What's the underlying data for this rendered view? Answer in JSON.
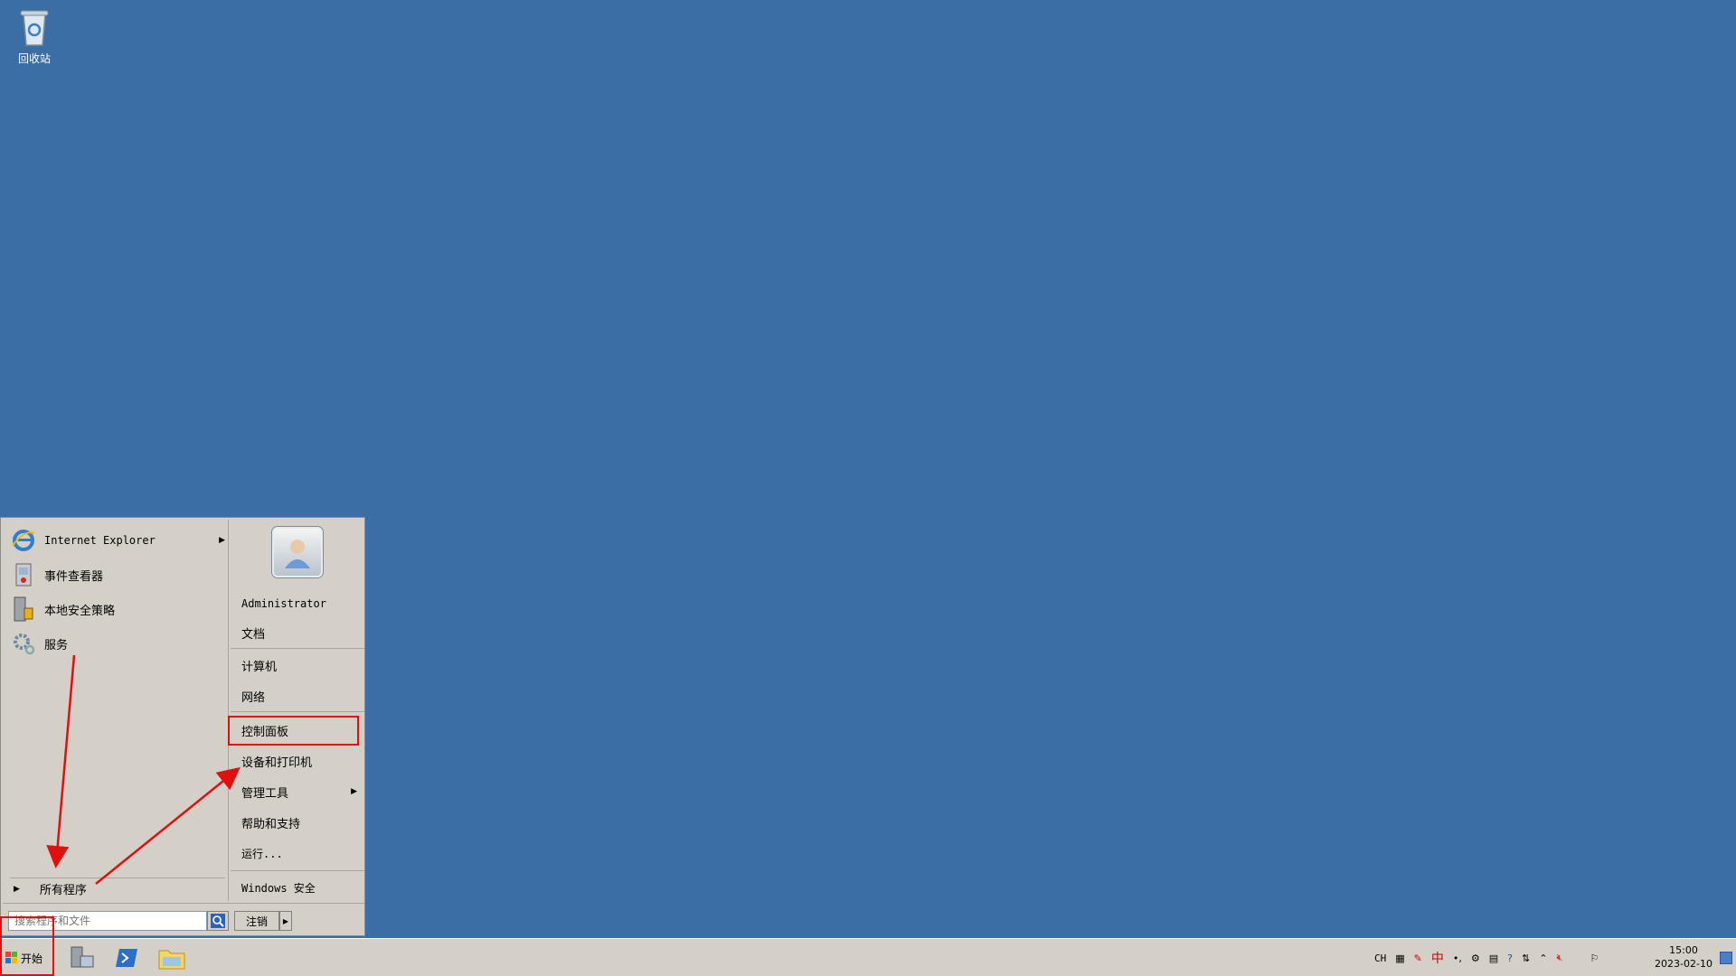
{
  "desktop": {
    "recycle_bin_label": "回收站"
  },
  "start_menu": {
    "programs": [
      {
        "label": "Internet Explorer",
        "icon": "internet-explorer-icon",
        "has_submenu": true
      },
      {
        "label": "事件查看器",
        "icon": "event-viewer-icon",
        "has_submenu": false
      },
      {
        "label": "本地安全策略",
        "icon": "local-security-policy-icon",
        "has_submenu": false
      },
      {
        "label": "服务",
        "icon": "services-gear-icon",
        "has_submenu": false
      }
    ],
    "all_programs_label": "所有程序",
    "user_name": "Administrator",
    "right_items": {
      "documents": "文档",
      "computer": "计算机",
      "network": "网络",
      "control_panel": "控制面板",
      "devices_printers": "设备和打印机",
      "admin_tools": "管理工具",
      "help_support": "帮助和支持",
      "run": "运行...",
      "windows_security": "Windows 安全"
    },
    "search_placeholder": "搜索程序和文件",
    "logoff_label": "注销"
  },
  "taskbar": {
    "start_label": "开始",
    "tray": {
      "lang": "CH",
      "ime": "中"
    },
    "clock_time": "15:00",
    "clock_date": "2023-02-10"
  },
  "colors": {
    "desktop": "#3a6ea5",
    "menu_bg": "#d4d0c8",
    "annotation": "#e01010"
  }
}
